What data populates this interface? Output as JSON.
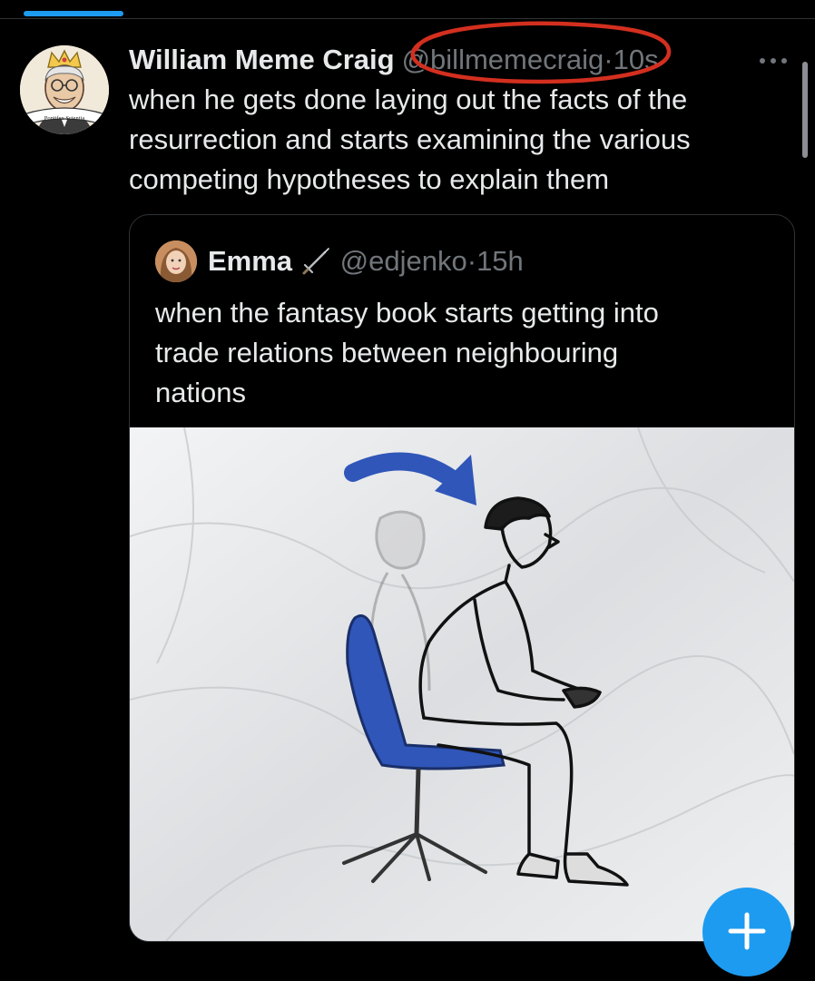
{
  "post": {
    "display_name": "William Meme Craig",
    "handle": "@billmemecraig",
    "separator": "·",
    "time": "10s",
    "text_lines": [
      "when he gets done laying out the facts of the",
      "resurrection and starts examining the various",
      "competing hypotheses to explain them"
    ],
    "avatar_caption": "Pontifex Scientia"
  },
  "quoted_post": {
    "display_name": "Emma",
    "handle": "@edjenko",
    "separator": "·",
    "time": "15h",
    "text_lines": [
      "when the fantasy book starts getting into",
      "trade relations between neighbouring",
      "nations"
    ]
  },
  "icons": {
    "more": "more-horizontal-icon",
    "sword": "sword-icon",
    "fab": "compose-post-icon"
  },
  "colors": {
    "background": "#000000",
    "text_primary": "#e7e9ea",
    "text_secondary": "#71767b",
    "accent": "#1d9bf0",
    "annotation_circle": "#d32f1f",
    "chair_blue": "#2f56b8",
    "arrow_blue": "#2f56b8"
  }
}
